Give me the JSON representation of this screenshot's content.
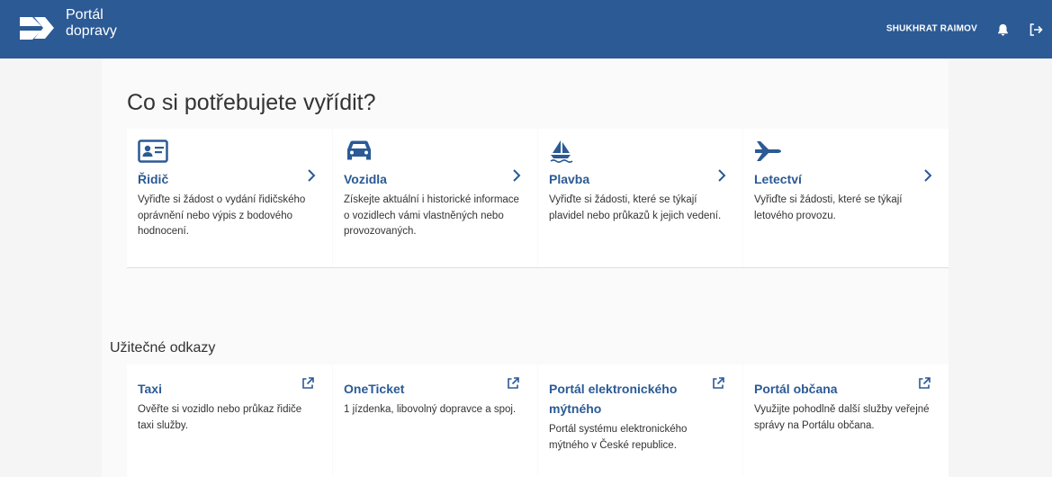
{
  "header": {
    "brand_line1": "Portál",
    "brand_line2": "dopravy",
    "user_name": "SHUKHRAT RAIMOV",
    "bg_color": "#2b5a95"
  },
  "main": {
    "heading": "Co si potřebujete vyřídit?",
    "categories": [
      {
        "icon": "id-card-icon",
        "title": "Řidič",
        "desc": "Vyřiďte si žádost o vydání řidičského oprávnění nebo výpis z bodového hodnocení."
      },
      {
        "icon": "car-icon",
        "title": "Vozidla",
        "desc": "Získejte aktuální i historické informace o vozidlech vámi vlastněných nebo provozovaných."
      },
      {
        "icon": "sailboat-icon",
        "title": "Plavba",
        "desc": "Vyřiďte si žádosti, které se týkají plavidel nebo průkazů k jejich vedení."
      },
      {
        "icon": "airplane-icon",
        "title": "Letectví",
        "desc": "Vyřiďte si žádosti, které se týkají letového provozu."
      }
    ],
    "links_heading": "Užitečné odkazy",
    "links": [
      {
        "title": "Taxi",
        "desc": "Ověřte si vozidlo nebo průkaz řidiče taxi služby."
      },
      {
        "title": "OneTicket",
        "desc": "1 jízdenka, libovolný dopravce a spoj."
      },
      {
        "title": "Portál elektronického mýtného",
        "desc": "Portál systému elektronického mýtného v České republice."
      },
      {
        "title": "Portál občana",
        "desc": "Využijte pohodlně další služby veřejné správy na Portálu občana."
      }
    ]
  }
}
